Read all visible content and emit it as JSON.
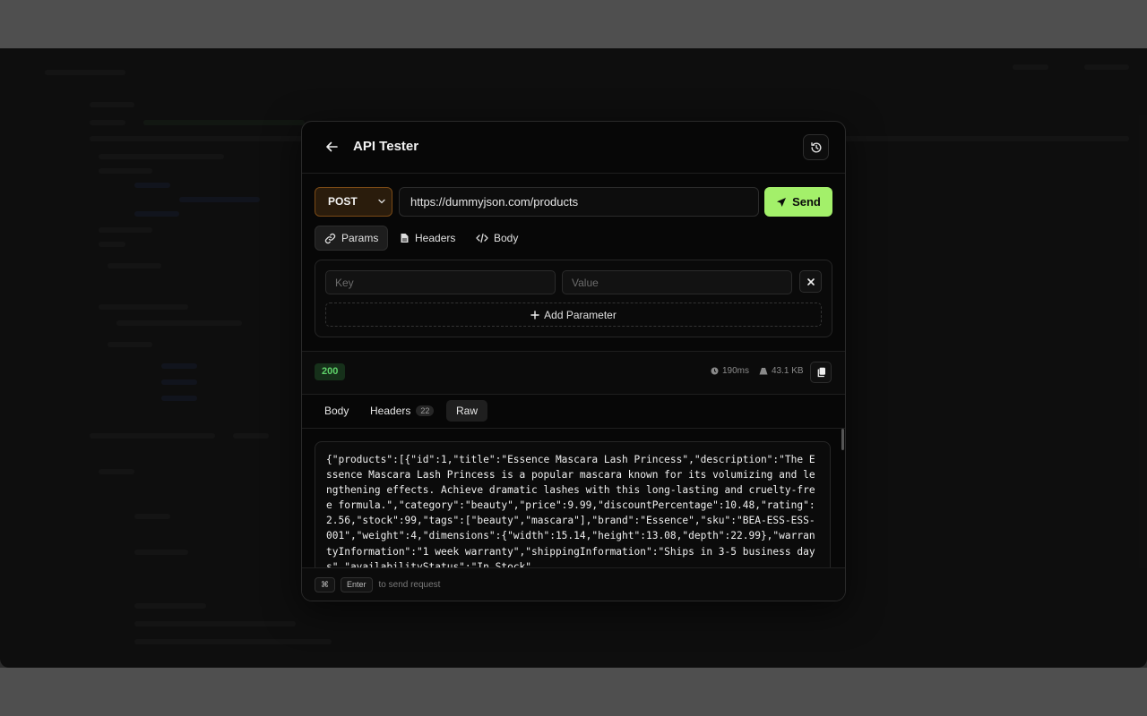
{
  "header": {
    "title": "API Tester",
    "back_icon": "arrow-left-icon",
    "history_icon": "history-icon"
  },
  "request": {
    "method": "POST",
    "url": "https://dummyjson.com/products",
    "send_label": "Send",
    "tabs": [
      {
        "label": "Params",
        "icon": "link-icon",
        "active": true
      },
      {
        "label": "Headers",
        "icon": "file-icon",
        "active": false
      },
      {
        "label": "Body",
        "icon": "code-icon",
        "active": false
      }
    ],
    "params": {
      "key_placeholder": "Key",
      "value_placeholder": "Value",
      "add_label": "Add Parameter"
    }
  },
  "response": {
    "status": "200",
    "time": "190ms",
    "size": "43.1 KB",
    "tabs": [
      {
        "label": "Body",
        "active": false
      },
      {
        "label": "Headers",
        "count": "22",
        "active": false
      },
      {
        "label": "Raw",
        "active": true
      }
    ],
    "raw": "{\"products\":[{\"id\":1,\"title\":\"Essence Mascara Lash Princess\",\"description\":\"The Essence Mascara Lash Princess is a popular mascara known for its volumizing and lengthening effects. Achieve dramatic lashes with this long-lasting and cruelty-free formula.\",\"category\":\"beauty\",\"price\":9.99,\"discountPercentage\":10.48,\"rating\":2.56,\"stock\":99,\"tags\":[\"beauty\",\"mascara\"],\"brand\":\"Essence\",\"sku\":\"BEA-ESS-ESS-001\",\"weight\":4,\"dimensions\":{\"width\":15.14,\"height\":13.08,\"depth\":22.99},\"warrantyInformation\":\"1 week warranty\",\"shippingInformation\":\"Ships in 3-5 business days\",\"availabilityStatus\":\"In Stock\""
  },
  "footer": {
    "key1": "⌘",
    "key2": "Enter",
    "hint": "to send request"
  },
  "colors": {
    "accent": "#a3f06a",
    "status_ok": "#5fd36a",
    "method_border": "#7a4a16"
  }
}
